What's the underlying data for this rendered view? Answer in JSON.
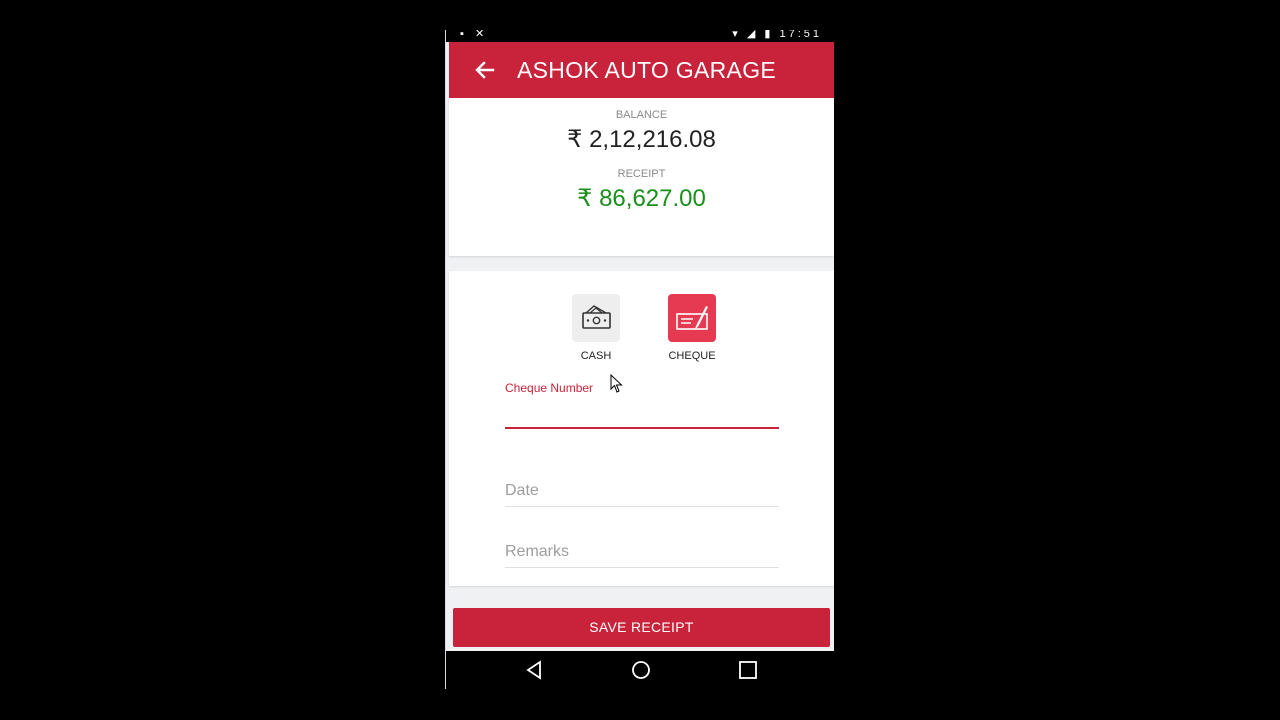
{
  "status_bar": {
    "left_icons": [
      "notification-icon",
      "call-missed-icon"
    ],
    "right_icons": [
      "wifi-icon",
      "no-signal-icon",
      "battery-icon"
    ],
    "time": "17:51"
  },
  "app_bar": {
    "title": "ASHOK AUTO GARAGE",
    "back_icon": "arrow-left-icon",
    "color": "#c8233a"
  },
  "summary": {
    "balance_label": "BALANCE",
    "balance_value": "₹ 2,12,216.08",
    "receipt_label": "RECEIPT",
    "receipt_value": "₹ 86,627.00",
    "receipt_color": "#1b8f1b"
  },
  "payment_modes": [
    {
      "label": "CASH",
      "icon": "cash-icon",
      "selected": false
    },
    {
      "label": "CHEQUE",
      "icon": "cheque-icon",
      "selected": true
    }
  ],
  "form": {
    "cheque_number": {
      "label": "Cheque Number",
      "value": ""
    },
    "date": {
      "placeholder": "Date",
      "value": ""
    },
    "remarks": {
      "placeholder": "Remarks",
      "value": ""
    }
  },
  "save_button": {
    "label": "SAVE RECEIPT"
  },
  "nav_bar": [
    "back-triangle-icon",
    "home-circle-icon",
    "recents-square-icon"
  ]
}
